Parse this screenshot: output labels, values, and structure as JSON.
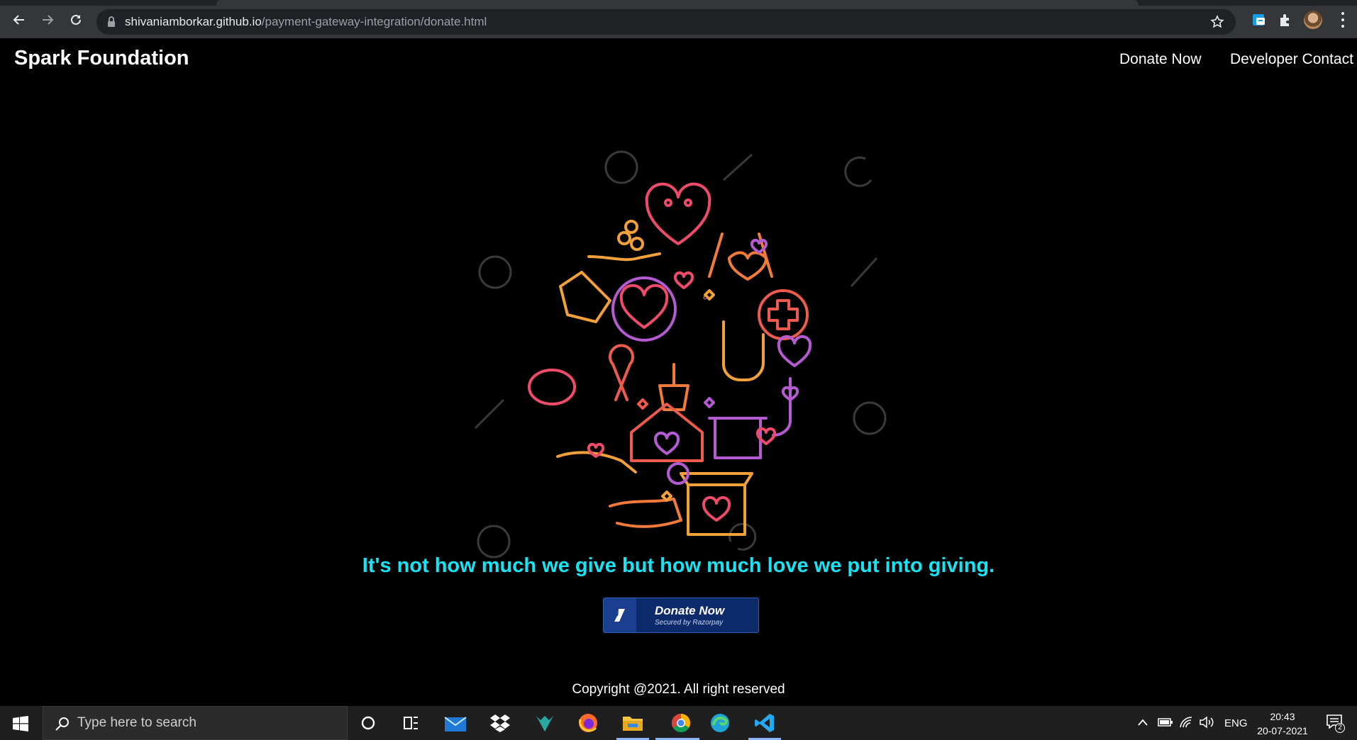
{
  "browser": {
    "url_host": "shivaniamborkar.github.io",
    "url_path": "/payment-gateway-integration/donate.html"
  },
  "site": {
    "title": "Spark Foundation",
    "nav": [
      {
        "label": "Donate Now"
      },
      {
        "label": "Developer Contact"
      }
    ],
    "tagline": "It's not how much we give but how much love we put into giving.",
    "donate_button": {
      "label": "Donate Now",
      "sublabel": "Secured by Razorpay"
    },
    "copyright": "Copyright @2021. All right reserved"
  },
  "taskbar": {
    "search_placeholder": "Type here to search",
    "language": "ENG",
    "time": "20:43",
    "date": "20-07-2021",
    "notification_count": "2"
  },
  "colors": {
    "tagline": "#19e3f2",
    "page_bg": "#000000",
    "razorpay_blue": "#0d2b6b"
  }
}
